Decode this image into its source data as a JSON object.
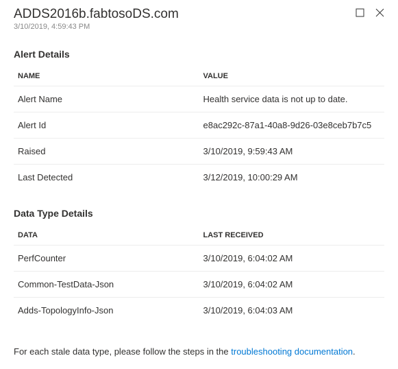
{
  "header": {
    "title": "ADDS2016b.fabtosoDS.com",
    "timestamp": "3/10/2019, 4:59:43 PM"
  },
  "alert_details": {
    "title": "Alert Details",
    "columns": {
      "name": "NAME",
      "value": "VALUE"
    },
    "rows": [
      {
        "name": "Alert Name",
        "value": "Health service data is not up to date."
      },
      {
        "name": "Alert Id",
        "value": "e8ac292c-87a1-40a8-9d26-03e8ceb7b7c5"
      },
      {
        "name": "Raised",
        "value": "3/10/2019, 9:59:43 AM"
      },
      {
        "name": "Last Detected",
        "value": "3/12/2019, 10:00:29 AM"
      }
    ]
  },
  "data_type_details": {
    "title": "Data Type Details",
    "columns": {
      "data": "DATA",
      "last_received": "LAST RECEIVED"
    },
    "rows": [
      {
        "data": "PerfCounter",
        "last_received": "3/10/2019, 6:04:02 AM"
      },
      {
        "data": "Common-TestData-Json",
        "last_received": "3/10/2019, 6:04:02 AM"
      },
      {
        "data": "Adds-TopologyInfo-Json",
        "last_received": "3/10/2019, 6:04:03 AM"
      }
    ]
  },
  "footer": {
    "prefix": "For each stale data type, please follow the steps in the ",
    "link_text": "troubleshooting documentation",
    "suffix": "."
  }
}
